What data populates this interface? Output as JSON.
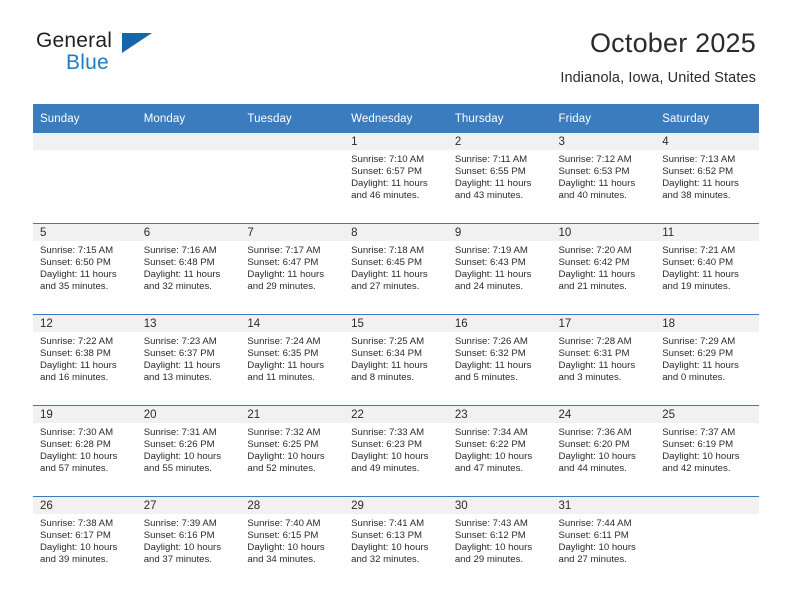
{
  "brand": {
    "name_top": "General",
    "name_bottom": "Blue",
    "accent_color": "#1f7dc4",
    "triangle_color": "#1767a8"
  },
  "header": {
    "title": "October 2025",
    "subtitle": "Indianola, Iowa, United States"
  },
  "calendar": {
    "header_bg": "#3a7cbe",
    "daynum_bg": "#f1f1f1",
    "weekdays": [
      "Sunday",
      "Monday",
      "Tuesday",
      "Wednesday",
      "Thursday",
      "Friday",
      "Saturday"
    ],
    "weeks": [
      [
        {
          "day": "",
          "sunrise": "",
          "sunset": "",
          "daylight_line1": "",
          "daylight_line2": "",
          "empty": true
        },
        {
          "day": "",
          "sunrise": "",
          "sunset": "",
          "daylight_line1": "",
          "daylight_line2": "",
          "empty": true
        },
        {
          "day": "",
          "sunrise": "",
          "sunset": "",
          "daylight_line1": "",
          "daylight_line2": "",
          "empty": true
        },
        {
          "day": "1",
          "sunrise": "Sunrise: 7:10 AM",
          "sunset": "Sunset: 6:57 PM",
          "daylight_line1": "Daylight: 11 hours",
          "daylight_line2": "and 46 minutes."
        },
        {
          "day": "2",
          "sunrise": "Sunrise: 7:11 AM",
          "sunset": "Sunset: 6:55 PM",
          "daylight_line1": "Daylight: 11 hours",
          "daylight_line2": "and 43 minutes."
        },
        {
          "day": "3",
          "sunrise": "Sunrise: 7:12 AM",
          "sunset": "Sunset: 6:53 PM",
          "daylight_line1": "Daylight: 11 hours",
          "daylight_line2": "and 40 minutes."
        },
        {
          "day": "4",
          "sunrise": "Sunrise: 7:13 AM",
          "sunset": "Sunset: 6:52 PM",
          "daylight_line1": "Daylight: 11 hours",
          "daylight_line2": "and 38 minutes."
        }
      ],
      [
        {
          "day": "5",
          "sunrise": "Sunrise: 7:15 AM",
          "sunset": "Sunset: 6:50 PM",
          "daylight_line1": "Daylight: 11 hours",
          "daylight_line2": "and 35 minutes."
        },
        {
          "day": "6",
          "sunrise": "Sunrise: 7:16 AM",
          "sunset": "Sunset: 6:48 PM",
          "daylight_line1": "Daylight: 11 hours",
          "daylight_line2": "and 32 minutes."
        },
        {
          "day": "7",
          "sunrise": "Sunrise: 7:17 AM",
          "sunset": "Sunset: 6:47 PM",
          "daylight_line1": "Daylight: 11 hours",
          "daylight_line2": "and 29 minutes."
        },
        {
          "day": "8",
          "sunrise": "Sunrise: 7:18 AM",
          "sunset": "Sunset: 6:45 PM",
          "daylight_line1": "Daylight: 11 hours",
          "daylight_line2": "and 27 minutes."
        },
        {
          "day": "9",
          "sunrise": "Sunrise: 7:19 AM",
          "sunset": "Sunset: 6:43 PM",
          "daylight_line1": "Daylight: 11 hours",
          "daylight_line2": "and 24 minutes."
        },
        {
          "day": "10",
          "sunrise": "Sunrise: 7:20 AM",
          "sunset": "Sunset: 6:42 PM",
          "daylight_line1": "Daylight: 11 hours",
          "daylight_line2": "and 21 minutes."
        },
        {
          "day": "11",
          "sunrise": "Sunrise: 7:21 AM",
          "sunset": "Sunset: 6:40 PM",
          "daylight_line1": "Daylight: 11 hours",
          "daylight_line2": "and 19 minutes."
        }
      ],
      [
        {
          "day": "12",
          "sunrise": "Sunrise: 7:22 AM",
          "sunset": "Sunset: 6:38 PM",
          "daylight_line1": "Daylight: 11 hours",
          "daylight_line2": "and 16 minutes."
        },
        {
          "day": "13",
          "sunrise": "Sunrise: 7:23 AM",
          "sunset": "Sunset: 6:37 PM",
          "daylight_line1": "Daylight: 11 hours",
          "daylight_line2": "and 13 minutes."
        },
        {
          "day": "14",
          "sunrise": "Sunrise: 7:24 AM",
          "sunset": "Sunset: 6:35 PM",
          "daylight_line1": "Daylight: 11 hours",
          "daylight_line2": "and 11 minutes."
        },
        {
          "day": "15",
          "sunrise": "Sunrise: 7:25 AM",
          "sunset": "Sunset: 6:34 PM",
          "daylight_line1": "Daylight: 11 hours",
          "daylight_line2": "and 8 minutes."
        },
        {
          "day": "16",
          "sunrise": "Sunrise: 7:26 AM",
          "sunset": "Sunset: 6:32 PM",
          "daylight_line1": "Daylight: 11 hours",
          "daylight_line2": "and 5 minutes."
        },
        {
          "day": "17",
          "sunrise": "Sunrise: 7:28 AM",
          "sunset": "Sunset: 6:31 PM",
          "daylight_line1": "Daylight: 11 hours",
          "daylight_line2": "and 3 minutes."
        },
        {
          "day": "18",
          "sunrise": "Sunrise: 7:29 AM",
          "sunset": "Sunset: 6:29 PM",
          "daylight_line1": "Daylight: 11 hours",
          "daylight_line2": "and 0 minutes."
        }
      ],
      [
        {
          "day": "19",
          "sunrise": "Sunrise: 7:30 AM",
          "sunset": "Sunset: 6:28 PM",
          "daylight_line1": "Daylight: 10 hours",
          "daylight_line2": "and 57 minutes."
        },
        {
          "day": "20",
          "sunrise": "Sunrise: 7:31 AM",
          "sunset": "Sunset: 6:26 PM",
          "daylight_line1": "Daylight: 10 hours",
          "daylight_line2": "and 55 minutes."
        },
        {
          "day": "21",
          "sunrise": "Sunrise: 7:32 AM",
          "sunset": "Sunset: 6:25 PM",
          "daylight_line1": "Daylight: 10 hours",
          "daylight_line2": "and 52 minutes."
        },
        {
          "day": "22",
          "sunrise": "Sunrise: 7:33 AM",
          "sunset": "Sunset: 6:23 PM",
          "daylight_line1": "Daylight: 10 hours",
          "daylight_line2": "and 49 minutes."
        },
        {
          "day": "23",
          "sunrise": "Sunrise: 7:34 AM",
          "sunset": "Sunset: 6:22 PM",
          "daylight_line1": "Daylight: 10 hours",
          "daylight_line2": "and 47 minutes."
        },
        {
          "day": "24",
          "sunrise": "Sunrise: 7:36 AM",
          "sunset": "Sunset: 6:20 PM",
          "daylight_line1": "Daylight: 10 hours",
          "daylight_line2": "and 44 minutes."
        },
        {
          "day": "25",
          "sunrise": "Sunrise: 7:37 AM",
          "sunset": "Sunset: 6:19 PM",
          "daylight_line1": "Daylight: 10 hours",
          "daylight_line2": "and 42 minutes."
        }
      ],
      [
        {
          "day": "26",
          "sunrise": "Sunrise: 7:38 AM",
          "sunset": "Sunset: 6:17 PM",
          "daylight_line1": "Daylight: 10 hours",
          "daylight_line2": "and 39 minutes."
        },
        {
          "day": "27",
          "sunrise": "Sunrise: 7:39 AM",
          "sunset": "Sunset: 6:16 PM",
          "daylight_line1": "Daylight: 10 hours",
          "daylight_line2": "and 37 minutes."
        },
        {
          "day": "28",
          "sunrise": "Sunrise: 7:40 AM",
          "sunset": "Sunset: 6:15 PM",
          "daylight_line1": "Daylight: 10 hours",
          "daylight_line2": "and 34 minutes."
        },
        {
          "day": "29",
          "sunrise": "Sunrise: 7:41 AM",
          "sunset": "Sunset: 6:13 PM",
          "daylight_line1": "Daylight: 10 hours",
          "daylight_line2": "and 32 minutes."
        },
        {
          "day": "30",
          "sunrise": "Sunrise: 7:43 AM",
          "sunset": "Sunset: 6:12 PM",
          "daylight_line1": "Daylight: 10 hours",
          "daylight_line2": "and 29 minutes."
        },
        {
          "day": "31",
          "sunrise": "Sunrise: 7:44 AM",
          "sunset": "Sunset: 6:11 PM",
          "daylight_line1": "Daylight: 10 hours",
          "daylight_line2": "and 27 minutes."
        },
        {
          "day": "",
          "sunrise": "",
          "sunset": "",
          "daylight_line1": "",
          "daylight_line2": "",
          "empty": true
        }
      ]
    ]
  }
}
